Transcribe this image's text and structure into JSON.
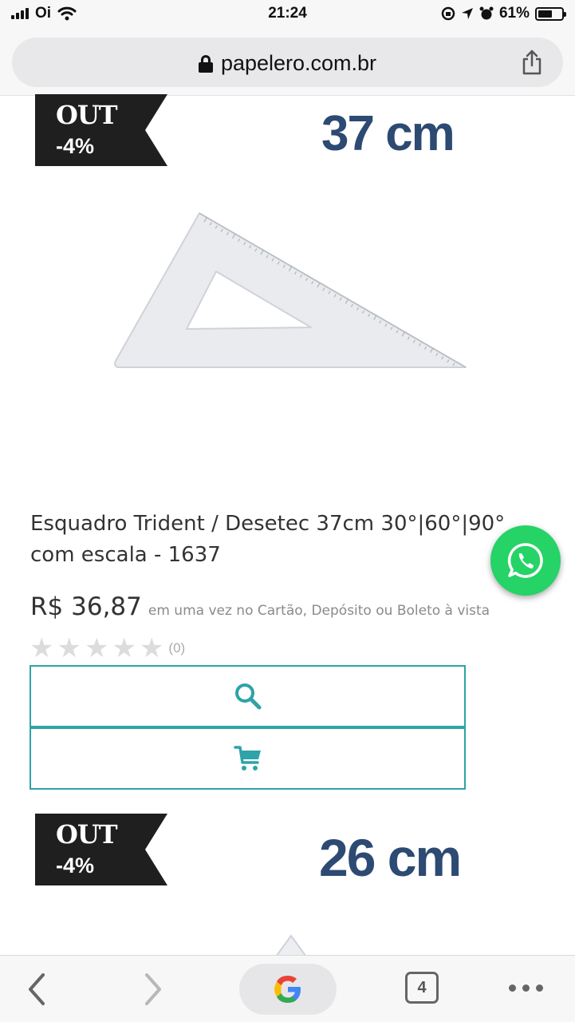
{
  "status_bar": {
    "carrier": "Oi",
    "time": "21:24",
    "battery": "61%",
    "battery_level": 0.61
  },
  "browser": {
    "url": "papelero.com.br",
    "tab_count": "4"
  },
  "products": [
    {
      "badge_top": "OUT",
      "badge_discount": "-4%",
      "image_label": "37 cm",
      "title": "Esquadro Trident / Desetec 37cm 30°|60°|90° com escala - 1637",
      "price": "R$ 36,87",
      "price_note": "em uma vez no Cartão, Depósito ou Boleto à vista",
      "rating": 0,
      "review_count": "(0)"
    },
    {
      "badge_top": "OUT",
      "badge_discount": "-4%",
      "image_label": "26 cm"
    }
  ],
  "icons": {
    "search": "search-icon",
    "cart": "cart-icon",
    "whatsapp": "whatsapp-icon",
    "share": "share-icon",
    "lock": "lock-icon"
  },
  "colors": {
    "accent": "#2ea3a8",
    "label_blue": "#2c4a72",
    "badge_bg": "#1f1f1f",
    "whatsapp": "#25d366",
    "star_empty": "#dcdcdc"
  }
}
